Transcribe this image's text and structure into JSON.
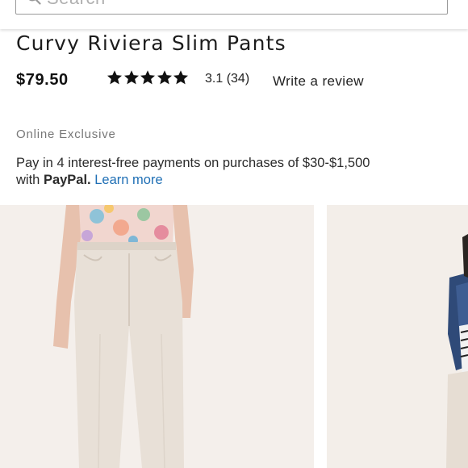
{
  "search": {
    "placeholder": "Search",
    "icon": "search-icon"
  },
  "product": {
    "title": "Curvy Riviera Slim Pants",
    "price": "$79.50",
    "rating": {
      "stars": 5,
      "text": "3.1 (34)"
    },
    "write_review": "Write a review",
    "badge": "Online Exclusive"
  },
  "paypal": {
    "line1": "Pay in 4 interest-free payments on purchases of $30-$1,500",
    "with": "with",
    "brand": "PayPal.",
    "learn_more": "Learn more"
  },
  "colors": {
    "link": "#1f6fb5",
    "text": "#222222",
    "muted": "#777777",
    "image_bg": "#f4efeb",
    "pants": "#e8e0d7"
  }
}
